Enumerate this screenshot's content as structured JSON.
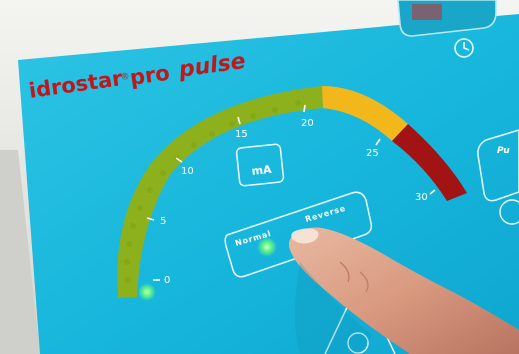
{
  "brand": {
    "name": "idrostar",
    "registered": "®",
    "model": "pro",
    "variant": "pulse"
  },
  "gauge": {
    "ticks": [
      "0",
      "5",
      "10",
      "15",
      "20",
      "25",
      "30"
    ],
    "unit_label": "mA",
    "zone_colors": {
      "low": "#8db11c",
      "mid": "#f2b71b",
      "high": "#a11413"
    },
    "indicator_color": "#6bff7a"
  },
  "mode_selector": {
    "normal_label": "Normal",
    "reverse_label": "Reverse",
    "active": "Normal"
  },
  "side_button": {
    "label_fragment": "Pu"
  },
  "panel_color": "#18b8db"
}
